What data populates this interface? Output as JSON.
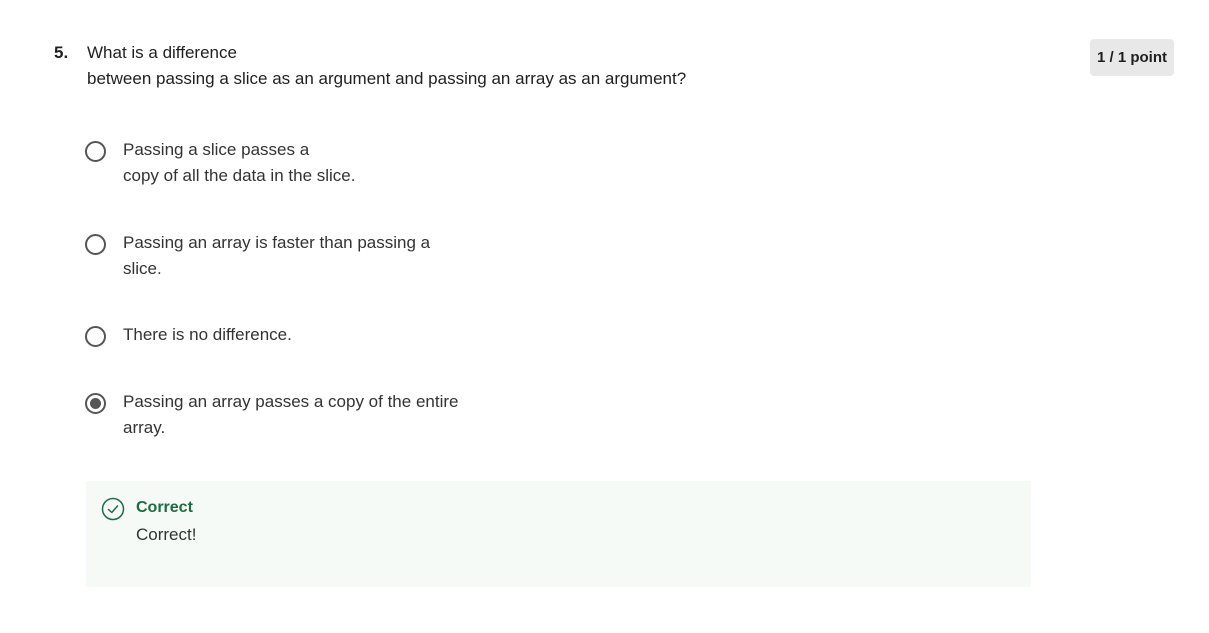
{
  "question": {
    "number": "5.",
    "text_line1": "What is a difference",
    "text_line2": "between passing a slice as an argument and passing an array as an argument?",
    "points": "1 / 1 point"
  },
  "options": [
    {
      "line1": "Passing a slice passes a",
      "line2": "copy of all the data in the slice.",
      "selected": false
    },
    {
      "line1": "Passing an array is faster than passing a",
      "line2": "slice.",
      "selected": false
    },
    {
      "line1": "There is no difference.",
      "line2": "",
      "selected": false
    },
    {
      "line1": "Passing an array passes a copy of the entire",
      "line2": "array.",
      "selected": true
    }
  ],
  "feedback": {
    "title": "Correct",
    "message": "Correct!",
    "icon": "check-circle-icon",
    "color": "#1e6b43"
  }
}
